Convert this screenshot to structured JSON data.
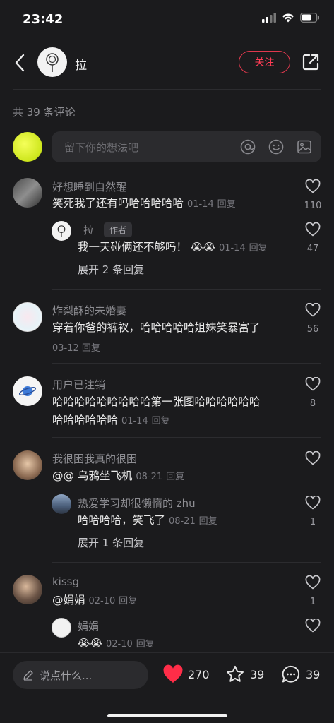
{
  "status": {
    "time": "23:42"
  },
  "header": {
    "author": "拉",
    "follow_label": "关注"
  },
  "comment_count_label": "共 39 条评论",
  "input": {
    "placeholder": "留下你的想法吧"
  },
  "comments": [
    {
      "name": "好想睡到自然醒",
      "text": "笑死我了还有吗哈哈哈哈哈",
      "date": "01-14",
      "reply_label": "回复",
      "likes": "110",
      "replies": [
        {
          "name": "拉",
          "tag": "作者",
          "text": "我一天碰俩还不够吗！",
          "date": "01-14",
          "reply_label": "回复",
          "likes": "47"
        }
      ],
      "expand_label": "展开 2 条回复"
    },
    {
      "name": "炸梨酥的未婚妻",
      "text": "穿着你爸的裤衩，哈哈哈哈哈姐妹笑暴富了",
      "date": "03-12",
      "reply_label": "回复",
      "likes": "56"
    },
    {
      "name": "用户已注销",
      "text_line1": "哈哈哈哈哈哈哈哈哈第一张图哈哈哈哈哈哈",
      "text_line2": "哈哈哈哈哈哈",
      "date": "01-14",
      "reply_label": "回复",
      "likes": "8"
    },
    {
      "name": "我很困我真的很困",
      "text": "@@ 乌鸦坐飞机",
      "date": "08-21",
      "reply_label": "回复",
      "likes": "",
      "replies": [
        {
          "name": "热爱学习却很懒惰的 zhu",
          "text": "哈哈哈哈，笑飞了",
          "date": "08-21",
          "reply_label": "回复",
          "likes": "1"
        }
      ],
      "expand_label": "展开 1 条回复"
    },
    {
      "name": "kissg",
      "text": "@娟娟",
      "date": "02-10",
      "reply_label": "回复",
      "likes": "1",
      "replies": [
        {
          "name": "娟娟",
          "text": "",
          "date": "02-10",
          "reply_label": "回复",
          "likes": ""
        }
      ]
    }
  ],
  "bottom": {
    "input_placeholder": "说点什么...",
    "likes": "270",
    "stars": "39",
    "comments": "39"
  },
  "colors": {
    "accent": "#ff3d55",
    "background": "#1b1b1d",
    "heart": "#ff2d48"
  }
}
